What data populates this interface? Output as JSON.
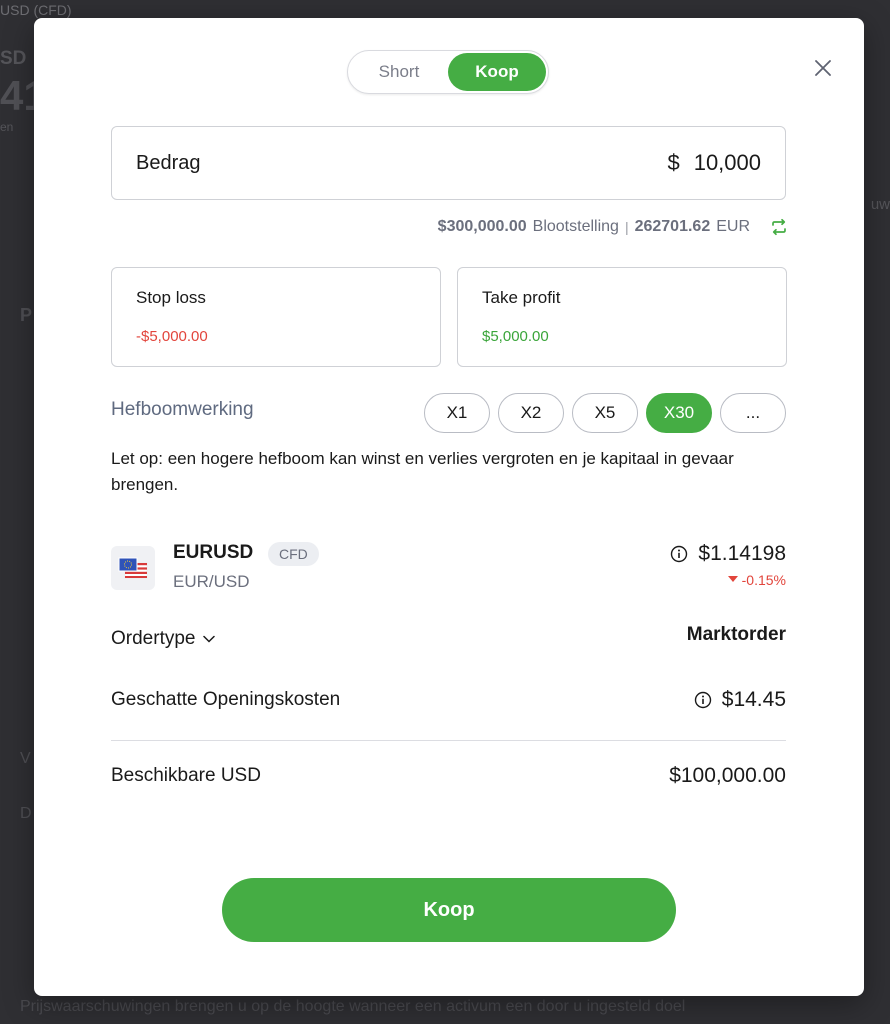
{
  "background": {
    "top_text": "USD (CFD)",
    "symbol_fragment": "SD",
    "price_fragment": "41",
    "sub_fragment": "en",
    "right_fragment": "uw",
    "left_p_fragment": "P",
    "left_v_fragment": "V",
    "left_d_fragment": "D",
    "bottom_text": "Prijswaarschuwingen brengen u op de hoogte wanneer een activum een door u ingesteld doel"
  },
  "modal": {
    "side_toggle": {
      "short_label": "Short",
      "buy_label": "Koop",
      "selected": "Koop"
    },
    "amount": {
      "label": "Bedrag",
      "currency_symbol": "$",
      "value": "10,000"
    },
    "exposure": {
      "amount": "$300,000.00",
      "label": "Blootstelling",
      "separator": "|",
      "converted_amount": "262701.62",
      "converted_currency": "EUR"
    },
    "stop_loss": {
      "label": "Stop loss",
      "value": "-$5,000.00"
    },
    "take_profit": {
      "label": "Take profit",
      "value": "$5,000.00"
    },
    "leverage": {
      "label": "Hefboomwerking",
      "options": [
        "X1",
        "X2",
        "X5",
        "X30",
        "..."
      ],
      "selected": "X30"
    },
    "warning": "Let op: een hogere hefboom kan winst en verlies vergroten en je kapitaal in gevaar brengen.",
    "instrument": {
      "symbol": "EURUSD",
      "badge": "CFD",
      "pair": "EUR/USD",
      "price": "$1.14198",
      "change": "-0.15%"
    },
    "order_type": {
      "label": "Ordertype",
      "value": "Marktorder"
    },
    "opening_costs": {
      "label": "Geschatte Openingskosten",
      "value": "$14.45"
    },
    "available": {
      "label": "Beschikbare USD",
      "value": "$100,000.00"
    },
    "submit_label": "Koop"
  },
  "colors": {
    "accent_green": "#45ad44",
    "negative_red": "#e2453c",
    "positive_green": "#3aa53a",
    "muted_text": "#6b6f7d"
  }
}
